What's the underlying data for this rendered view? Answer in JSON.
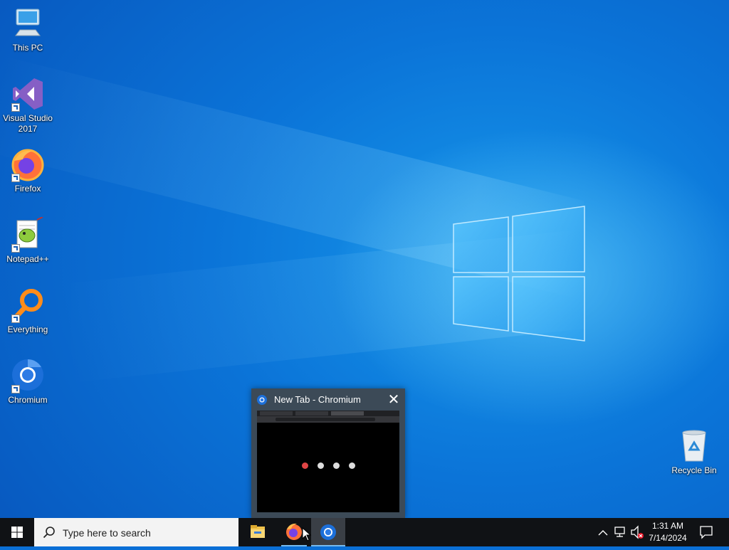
{
  "desktop": {
    "icons": [
      {
        "label": "This PC",
        "icon": "computer-icon"
      },
      {
        "label": "Visual Studio 2017",
        "icon": "visual-studio-icon"
      },
      {
        "label": "Firefox",
        "icon": "firefox-icon"
      },
      {
        "label": "Notepad++",
        "icon": "notepadpp-icon"
      },
      {
        "label": "Everything",
        "icon": "everything-search-icon"
      },
      {
        "label": "Chromium",
        "icon": "chromium-icon"
      },
      {
        "label": "Recycle Bin",
        "icon": "recycle-bin-icon"
      }
    ]
  },
  "thumbnail": {
    "title": "New Tab - Chromium",
    "close_symbol": "✕"
  },
  "taskbar": {
    "search_placeholder": "Type here to search",
    "apps": [
      {
        "name": "File Explorer",
        "icon": "folder-icon",
        "active": false
      },
      {
        "name": "Firefox",
        "icon": "firefox-icon",
        "active": false
      },
      {
        "name": "Chromium",
        "icon": "chromium-icon",
        "active": true
      }
    ],
    "tray": {
      "time": "1:31 AM",
      "date": "7/14/2024"
    }
  },
  "colors": {
    "accent": "#76b9ed",
    "taskbar": "#101215",
    "desktop": "#0b74d8"
  }
}
